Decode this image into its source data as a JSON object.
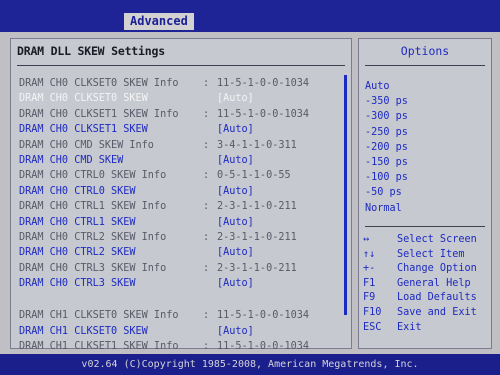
{
  "header": {
    "active_tab": "Advanced"
  },
  "main": {
    "title": "DRAM DLL SKEW Settings",
    "rows": [
      {
        "label": "DRAM CH0 CLKSET0 SKEW Info",
        "value": "11-5-1-0-0-1034",
        "kind": "info"
      },
      {
        "label": "DRAM CH0 CLKSET0 SKEW",
        "value": "[Auto]",
        "kind": "selected"
      },
      {
        "label": "DRAM CH0 CLKSET1 SKEW Info",
        "value": "11-5-1-0-0-1034",
        "kind": "info"
      },
      {
        "label": "DRAM CH0 CLKSET1 SKEW",
        "value": "[Auto]",
        "kind": "skew"
      },
      {
        "label": "DRAM CH0 CMD SKEW Info",
        "value": "3-4-1-1-0-311",
        "kind": "info"
      },
      {
        "label": "DRAM CH0 CMD SKEW",
        "value": "[Auto]",
        "kind": "skew"
      },
      {
        "label": "DRAM CH0 CTRL0 SKEW Info",
        "value": "0-5-1-1-0-55",
        "kind": "info"
      },
      {
        "label": "DRAM CH0 CTRL0 SKEW",
        "value": "[Auto]",
        "kind": "skew"
      },
      {
        "label": "DRAM CH0 CTRL1 SKEW Info",
        "value": "2-3-1-1-0-211",
        "kind": "info"
      },
      {
        "label": "DRAM CH0 CTRL1 SKEW",
        "value": "[Auto]",
        "kind": "skew"
      },
      {
        "label": "DRAM CH0 CTRL2 SKEW Info",
        "value": "2-3-1-1-0-211",
        "kind": "info"
      },
      {
        "label": "DRAM CH0 CTRL2 SKEW",
        "value": "[Auto]",
        "kind": "skew"
      },
      {
        "label": "DRAM CH0 CTRL3 SKEW Info",
        "value": "2-3-1-1-0-211",
        "kind": "info"
      },
      {
        "label": "DRAM CH0 CTRL3 SKEW",
        "value": "[Auto]",
        "kind": "skew"
      },
      {
        "label": "DRAM CH1 CLKSET0 SKEW Info",
        "value": "11-5-1-0-0-1034",
        "kind": "info"
      },
      {
        "label": "DRAM CH1 CLKSET0 SKEW",
        "value": "[Auto]",
        "kind": "skew"
      },
      {
        "label": "DRAM CH1 CLKSET1 SKEW Info",
        "value": "11-5-1-0-0-1034",
        "kind": "info"
      }
    ]
  },
  "options": {
    "title": "Options",
    "items": [
      "Auto",
      "-350 ps",
      "-300 ps",
      "-250 ps",
      "-200 ps",
      "-150 ps",
      "-100 ps",
      "-50 ps",
      "Normal"
    ]
  },
  "help": [
    {
      "key": "↔",
      "desc": "Select Screen"
    },
    {
      "key": "↑↓",
      "desc": "Select Item"
    },
    {
      "key": "+-",
      "desc": "Change Option"
    },
    {
      "key": "F1",
      "desc": "General Help"
    },
    {
      "key": "F9",
      "desc": "Load Defaults"
    },
    {
      "key": "F10",
      "desc": "Save and Exit"
    },
    {
      "key": "ESC",
      "desc": "Exit"
    }
  ],
  "footer": {
    "text": "v02.64 (C)Copyright 1985-2008, American Megatrends, Inc."
  },
  "colors": {
    "background": "#1c1e8f",
    "panel": "#c7c9d0",
    "accent": "#1d2ac0",
    "selected": "#f4f4f6",
    "info": "#595968"
  }
}
